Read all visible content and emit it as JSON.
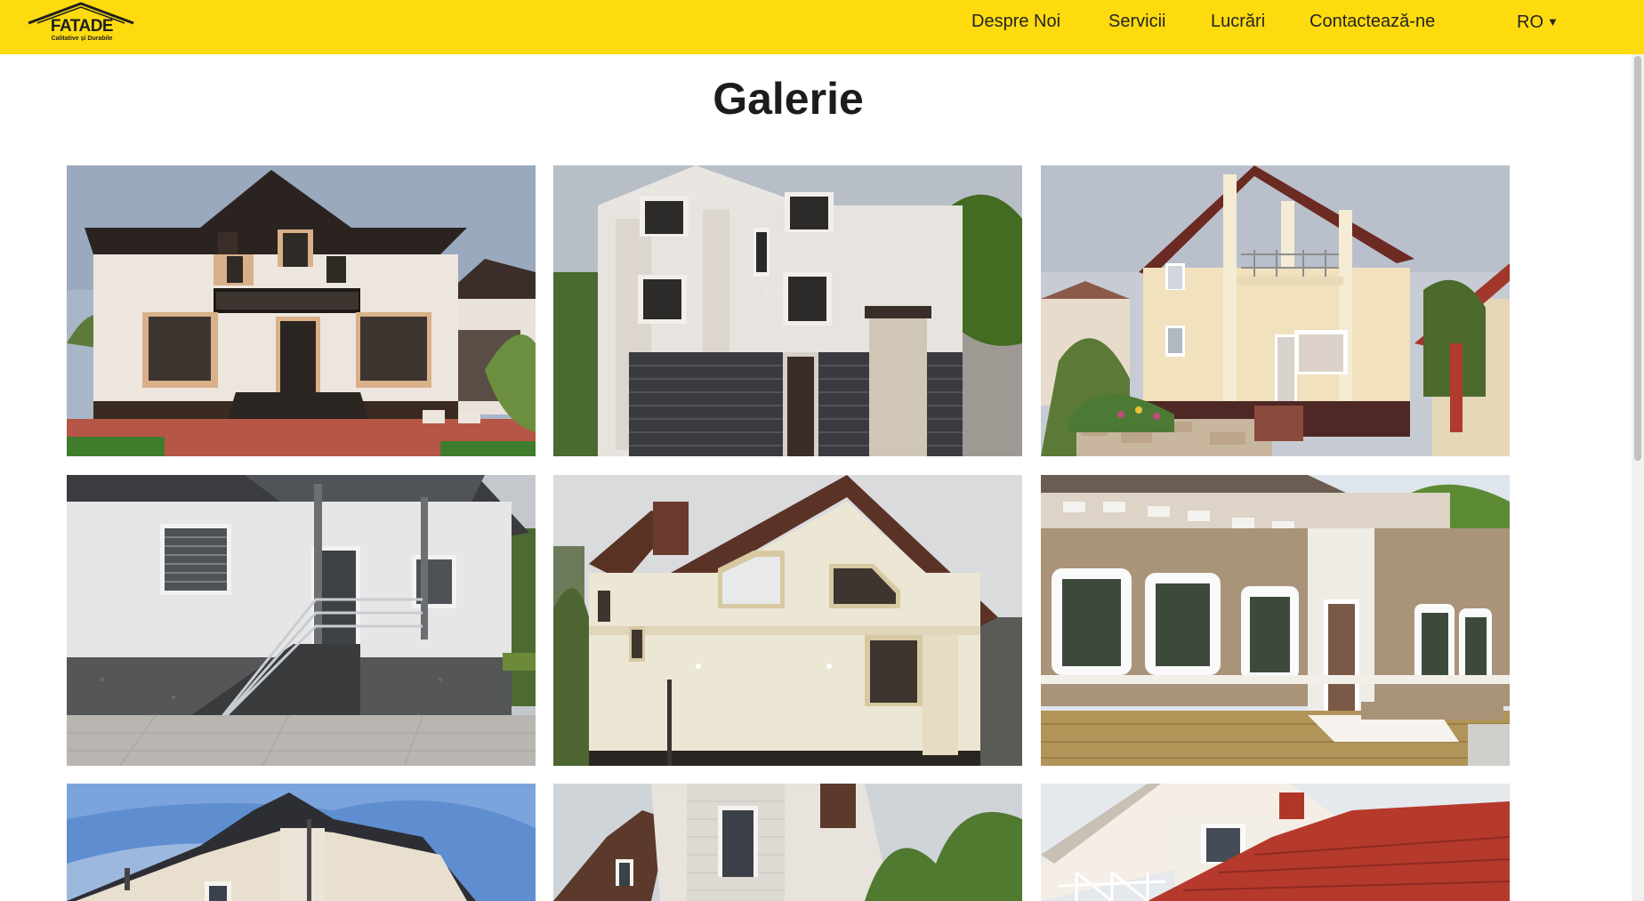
{
  "header": {
    "logo_text": "FATADE",
    "logo_tagline": "Calitative și Durabile",
    "nav": [
      {
        "label": "Despre Noi"
      },
      {
        "label": "Servicii"
      },
      {
        "label": "Lucrări"
      },
      {
        "label": "Contactează-ne"
      }
    ],
    "language": {
      "selected": "RO",
      "arrow": "▼"
    }
  },
  "main": {
    "title": "Galerie"
  },
  "colors": {
    "brand_yellow": "#fedb0f",
    "text_dark": "#242424"
  },
  "gallery": {
    "items": [
      {
        "icon": "house-photo"
      },
      {
        "icon": "house-photo"
      },
      {
        "icon": "house-photo"
      },
      {
        "icon": "house-photo"
      },
      {
        "icon": "house-photo"
      },
      {
        "icon": "house-photo"
      },
      {
        "icon": "house-photo"
      },
      {
        "icon": "house-photo"
      },
      {
        "icon": "house-photo"
      }
    ]
  }
}
